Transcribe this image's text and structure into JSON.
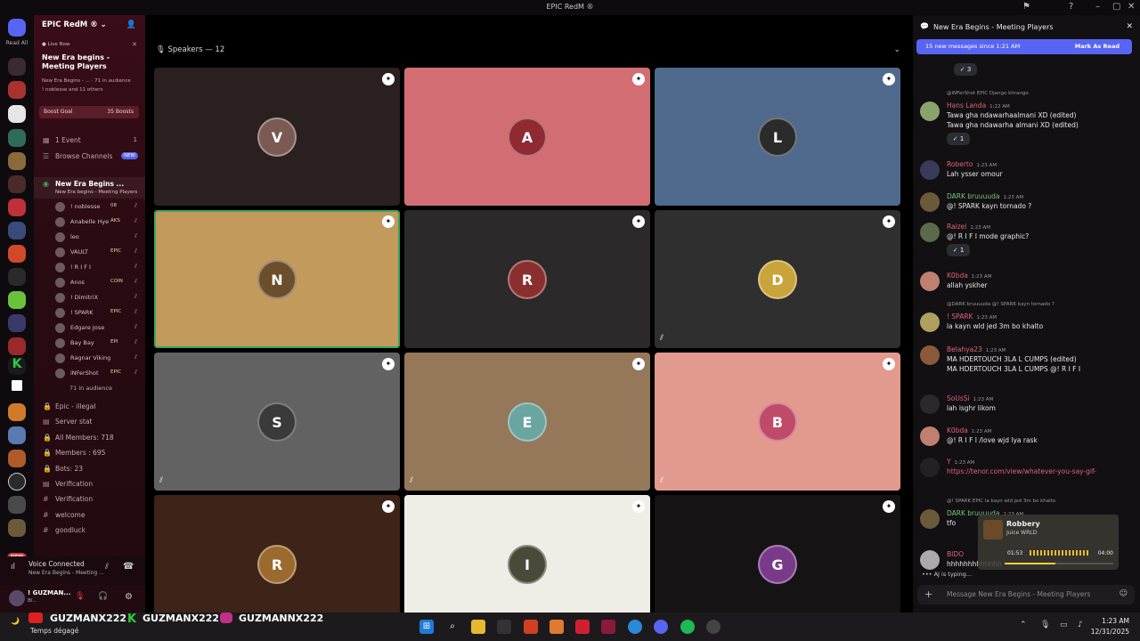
{
  "titlebar": {
    "title": "EPIC RedM ®"
  },
  "rail": {
    "read_all": "Read All",
    "new_badge": "NEW",
    "notif_count": "11"
  },
  "sidebar": {
    "server_name": "EPIC RedM ®",
    "live_label": "Live Now",
    "live_title": "New Era begins - Meeting Players",
    "live_meta": "New Era Begins - ... · 71 in audience",
    "live_people": "! noblesse and 11 others",
    "boost_goal": "Boost Goal",
    "boost_count": "35 Boosts",
    "event": "1 Event",
    "event_count": "1",
    "browse": "Browse Channels",
    "browse_badge": "NEW",
    "stage_channel": "New Era Begins ...",
    "stage_topic": "New Era begins - Meeting Players",
    "users": [
      {
        "name": "! noblesse",
        "tag": "08"
      },
      {
        "name": "Anabelle Hye",
        "tag": "AKS"
      },
      {
        "name": "leo",
        "tag": ""
      },
      {
        "name": "VAULT",
        "tag": "EPIC"
      },
      {
        "name": "! R I F I",
        "tag": ""
      },
      {
        "name": "Anos",
        "tag": "COIN"
      },
      {
        "name": "! DimitriX",
        "tag": ""
      },
      {
        "name": "! SPARK",
        "tag": "EPIC"
      },
      {
        "name": "Edgare Jose",
        "tag": ""
      },
      {
        "name": "Bay Bay",
        "tag": "EPI"
      },
      {
        "name": "Ragnar Viking",
        "tag": ""
      },
      {
        "name": "iNFerShot",
        "tag": "EPIC"
      }
    ],
    "in_audience": "71 in audience",
    "channels": [
      {
        "icon": "🔒",
        "name": "Epic - illegal"
      },
      {
        "icon": "▤",
        "name": "Server stat"
      },
      {
        "icon": "🔒",
        "name": "All Members: 718"
      },
      {
        "icon": "🔒",
        "name": "Members : 695"
      },
      {
        "icon": "🔒",
        "name": "Bots: 23"
      },
      {
        "icon": "▤",
        "name": "Verification"
      },
      {
        "icon": "#",
        "name": "Verification"
      },
      {
        "icon": "#",
        "name": "welcome"
      },
      {
        "icon": "#",
        "name": "goodluck"
      }
    ],
    "voice_status": "Voice Connected",
    "voice_channel": "New Era Begins - Meeting ...",
    "username": "! GUZMAN...",
    "user_status": "Bl..."
  },
  "stage": {
    "speakers_label": "Speakers — 12",
    "tiles": [
      {
        "bg": "#2a201f",
        "avatar_color": "#7a5a52",
        "initial": "V",
        "muted": false,
        "speaking": false
      },
      {
        "bg": "#d26e73",
        "avatar_color": "#8f2a33",
        "initial": "A",
        "muted": false,
        "speaking": false
      },
      {
        "bg": "#4f6a8c",
        "avatar_color": "#2b2b2b",
        "initial": "L",
        "muted": false,
        "speaking": false
      },
      {
        "bg": "#c19a5c",
        "avatar_color": "#6b4e2c",
        "initial": "N",
        "muted": false,
        "speaking": true
      },
      {
        "bg": "#2b2929",
        "avatar_color": "#8a2f2f",
        "initial": "R",
        "muted": false,
        "speaking": false
      },
      {
        "bg": "#2e2f2e",
        "avatar_color": "#c9a43a",
        "initial": "D",
        "muted": true,
        "speaking": false
      },
      {
        "bg": "#626262",
        "avatar_color": "#3a3a3a",
        "initial": "S",
        "muted": true,
        "speaking": false
      },
      {
        "bg": "#957759",
        "avatar_color": "#6aa5a0",
        "initial": "E",
        "muted": true,
        "speaking": false
      },
      {
        "bg": "#e29a8e",
        "avatar_color": "#c04a6a",
        "initial": "B",
        "muted": true,
        "speaking": false
      },
      {
        "bg": "#3d2318",
        "avatar_color": "#9b6a2e",
        "initial": "R",
        "muted": false,
        "speaking": false
      },
      {
        "bg": "#eeede6",
        "avatar_color": "#4a4a3a",
        "initial": "I",
        "muted": false,
        "speaking": false
      },
      {
        "bg": "#161314",
        "avatar_color": "#7a3a8a",
        "initial": "G",
        "muted": false,
        "speaking": false
      }
    ]
  },
  "chat": {
    "title": "New Era Begins - Meeting Players",
    "new_messages": "15 new messages since 1:21 AM",
    "mark_read": "Mark As Read",
    "top_reaction": "3",
    "messages": [
      {
        "reply": "@iNFerShot EPIC Django khrango",
        "author": "Hans Landa",
        "color": "#e0627a",
        "time": "1:22 AM",
        "lines": [
          "Tawa gha ndawarhaalmani XD (edited)",
          "Tawa gha ndawarha almani XD (edited)"
        ],
        "reaction": "1",
        "avatar": "#8aa36a"
      },
      {
        "reply": "",
        "author": "Roberto",
        "color": "#e0627a",
        "time": "1:23 AM",
        "lines": [
          "Lah ysser omour"
        ],
        "reaction": "",
        "avatar": "#3a3a5a"
      },
      {
        "reply": "",
        "author": "DARK bruuuuda",
        "color": "#7cc37c",
        "time": "1:23 AM",
        "lines": [
          "@! SPARK kayn tornado ?"
        ],
        "reaction": "",
        "avatar": "#6a5a3a"
      },
      {
        "reply": "",
        "author": "Raizel",
        "color": "#e0627a",
        "time": "1:23 AM",
        "lines": [
          "@! R I F I  mode graphic?"
        ],
        "reaction": "1",
        "avatar": "#5a6a4a"
      },
      {
        "reply": "",
        "author": "K0bda",
        "color": "#e0627a",
        "time": "1:23 AM",
        "lines": [
          "allah yskher"
        ],
        "reaction": "",
        "avatar": "#c08070"
      },
      {
        "reply": "@DARK bruuuuda @! SPARK kayn tornado ?",
        "author": "! SPARK",
        "color": "#e0627a",
        "time": "1:23 AM",
        "lines": [
          "la kayn wld jed 3m bo khalto"
        ],
        "reaction": "",
        "avatar": "#b0a060"
      },
      {
        "reply": "",
        "author": "Belahya23",
        "color": "#e0627a",
        "time": "1:23 AM",
        "lines": [
          "MA HDERTOUCH 3LA L CUMPS (edited)",
          "MA HDERTOUCH 3LA L CUMPS @! R I F I"
        ],
        "reaction": "",
        "avatar": "#8a5a3a"
      },
      {
        "reply": "",
        "author": "SoUsSi",
        "color": "#e0627a",
        "time": "1:23 AM",
        "lines": [
          "lah isghr likom"
        ],
        "reaction": "",
        "avatar": "#2a2a2a"
      },
      {
        "reply": "",
        "author": "K0bda",
        "color": "#e0627a",
        "time": "1:23 AM",
        "lines": [
          "@! R I F I  /love wjd lya rask"
        ],
        "reaction": "",
        "avatar": "#c08070"
      },
      {
        "reply": "",
        "author": "Y",
        "color": "#e0627a",
        "time": "1:23 AM",
        "lines": [
          "https://tenor.com/view/whatever-you-say-gif-"
        ],
        "reaction": "",
        "avatar": "#222"
      },
      {
        "reply": "@! SPARK EPIC la kayn wld jed 3m bo khalto",
        "author": "DARK bruuuuda",
        "color": "#7cc37c",
        "time": "1:23 AM",
        "lines": [
          "tfo"
        ],
        "reaction": "",
        "avatar": "#6a5a3a"
      },
      {
        "reply": "",
        "author": "BIDO",
        "color": "#e0627a",
        "time": "",
        "lines": [
          "hhhhhhhhhhhhh"
        ],
        "reaction": "",
        "avatar": "#aaa"
      }
    ],
    "typing": "AJ is typing...",
    "input_placeholder": "Message New Era Begins - Meeting Players"
  },
  "music": {
    "title": "Robbery",
    "artist": "Juice WRLD",
    "elapsed": "01:53",
    "total": "04:00",
    "progress": 0.47
  },
  "overlay": {
    "tags": [
      "GUZMANX222",
      "GUZMANX222",
      "GUZMANNX222"
    ],
    "weather": "Temps dégagé"
  },
  "taskbar": {
    "time": "1:23 AM",
    "date": "12/31/2025"
  }
}
